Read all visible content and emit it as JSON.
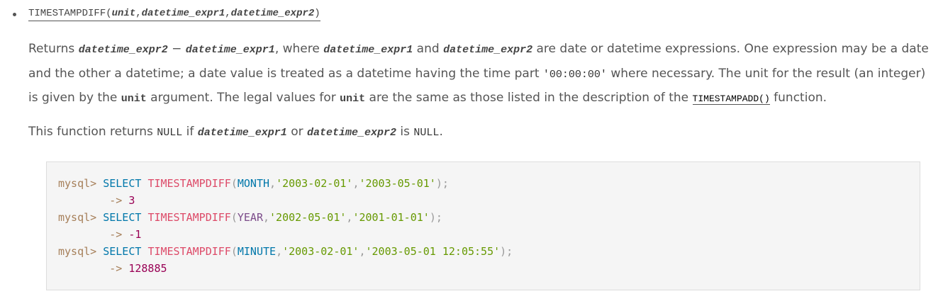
{
  "signature": {
    "fn": "TIMESTAMPDIFF",
    "open": "(",
    "arg1": "unit",
    "comma1": ",",
    "arg2": "datetime_expr1",
    "comma2": ",",
    "arg3": "datetime_expr2",
    "close": ")"
  },
  "para1": {
    "t1": "Returns ",
    "v1": "datetime_expr2",
    "t2": " − ",
    "v2": "datetime_expr1",
    "t3": ", where ",
    "v3": "datetime_expr1",
    "t4": " and ",
    "v4": "datetime_expr2",
    "t5": " are date or datetime expressions. One expression may be a date and the other a datetime; a date value is treated as a datetime having the time part ",
    "c1": "'00:00:00'",
    "t6": " where necessary. The unit for the result (an integer) is given by the ",
    "a1": "unit",
    "t7": " argument. The legal values for ",
    "a2": "unit",
    "t8": " are the same as those listed in the description of the ",
    "link": "TIMESTAMPADD()",
    "t9": " function."
  },
  "para2": {
    "t1": "This function returns ",
    "c1": "NULL",
    "t2": " if ",
    "v1": "datetime_expr1",
    "t3": " or ",
    "v2": "datetime_expr2",
    "t4": " is ",
    "c2": "NULL",
    "t5": "."
  },
  "code": {
    "lines": [
      {
        "prompt": "mysql>",
        "kw": "SELECT",
        "fn": "TIMESTAMPDIFF",
        "unit": "MONTH",
        "s1": "'2003-02-01'",
        "s2": "'2003-05-01'",
        "end": ");"
      },
      {
        "arrow": "->",
        "result": "3"
      },
      {
        "prompt": "mysql>",
        "kw": "SELECT",
        "fn": "TIMESTAMPDIFF",
        "unit": "YEAR",
        "s1": "'2002-05-01'",
        "s2": "'2001-01-01'",
        "end": ");"
      },
      {
        "arrow": "->",
        "result": "-1"
      },
      {
        "prompt": "mysql>",
        "kw": "SELECT",
        "fn": "TIMESTAMPDIFF",
        "unit": "MINUTE",
        "s1": "'2003-02-01'",
        "s2": "'2003-05-01 12:05:55'",
        "end": ");"
      },
      {
        "arrow": "->",
        "result": "128885"
      }
    ]
  },
  "colors": {
    "text": "#555555",
    "code_bg": "#f5f5f5",
    "keyword": "#0077aa",
    "function": "#dd4a68",
    "string": "#669900",
    "number": "#990055",
    "prompt": "#a67f59"
  }
}
